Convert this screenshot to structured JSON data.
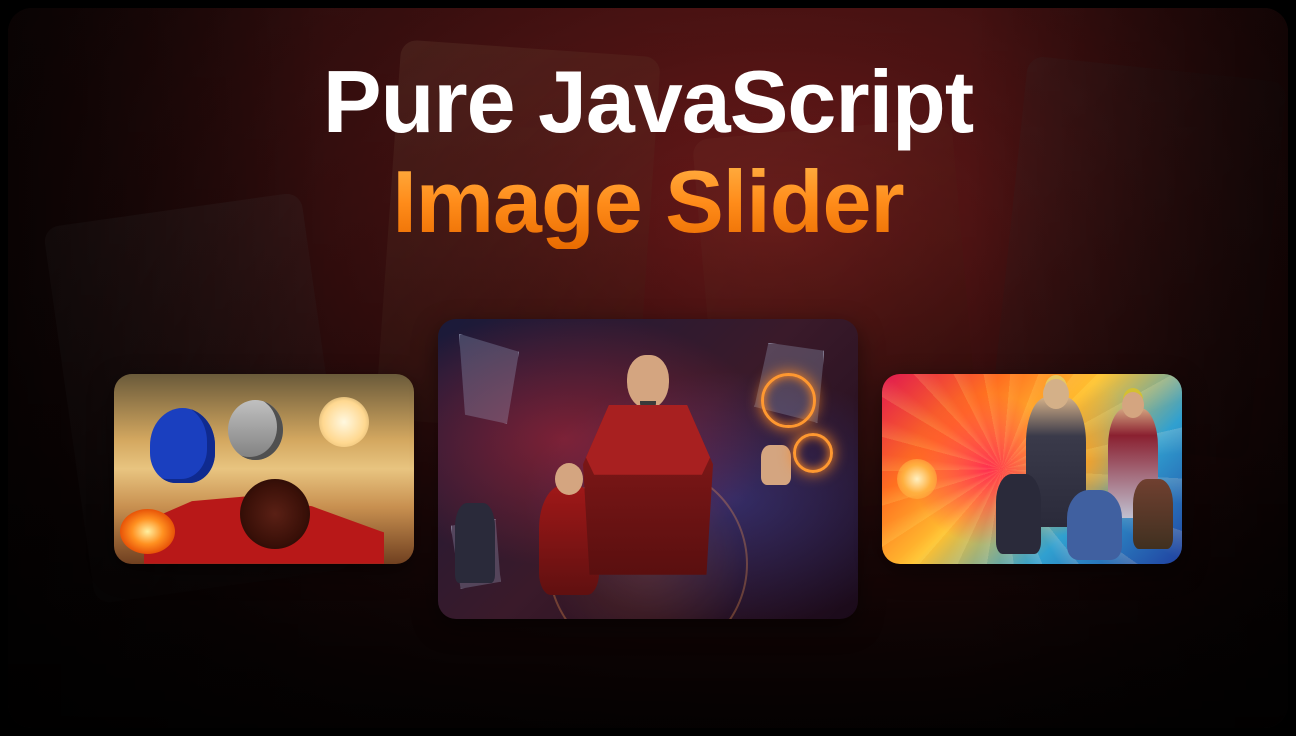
{
  "title": {
    "line1": "Pure JavaScript",
    "line2": "Image Slider"
  },
  "slides": [
    {
      "name": "sonic-biplane-slide",
      "position": "left"
    },
    {
      "name": "doctor-strange-slide",
      "position": "center"
    },
    {
      "name": "thor-colorful-slide",
      "position": "right"
    }
  ],
  "colors": {
    "accent_gradient_top": "#ffb347",
    "accent_gradient_bottom": "#e96b00",
    "bg_primary": "#5a1616"
  }
}
